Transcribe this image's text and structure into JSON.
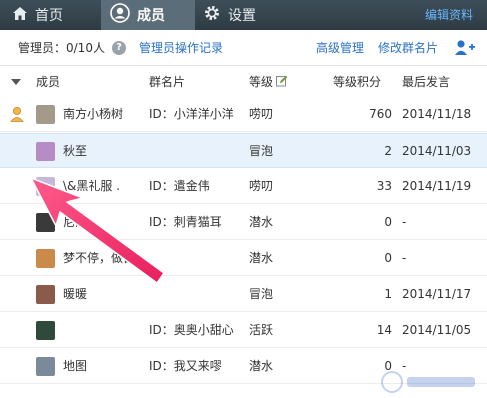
{
  "nav": {
    "tabs": [
      {
        "label": "首页",
        "icon": "home-icon",
        "active": false
      },
      {
        "label": "成员",
        "icon": "user-icon",
        "active": true
      },
      {
        "label": "设置",
        "icon": "gear-icon",
        "active": false
      }
    ],
    "edit_profile": "编辑资料"
  },
  "toolbar": {
    "admins": "管理员：0/10人",
    "admin_log": "管理员操作记录",
    "advanced_manage": "高级管理",
    "edit_group_card": "修改群名片"
  },
  "table": {
    "headers": [
      "成员",
      "群名片",
      "等级",
      "等级积分",
      "最后发言"
    ],
    "rows": [
      {
        "name": "南方小杨树",
        "card": "ID：小洋洋小洋",
        "level": "唠叨",
        "score": "760",
        "date": "2014/11/18",
        "owner": true,
        "selected": false,
        "avatar_color": "#a49a8a"
      },
      {
        "name": "秋至",
        "card": "",
        "level": "冒泡",
        "score": "2",
        "date": "2014/11/03",
        "owner": false,
        "selected": true,
        "avatar_color": "#b78cc4"
      },
      {
        "name": "\\&黑礼服 .",
        "card": "ID：遣金伟",
        "level": "唠叨",
        "score": "33",
        "date": "2014/11/19",
        "owner": false,
        "selected": false,
        "avatar_color": "#c7b8d6"
      },
      {
        "name": "尼洛",
        "card": "ID：刺青猫耳",
        "level": "潜水",
        "score": "0",
        "date": "-",
        "owner": false,
        "selected": false,
        "avatar_color": "#3a3a3a"
      },
      {
        "name": "梦不停，做目...",
        "card": "",
        "level": "潜水",
        "score": "0",
        "date": "-",
        "owner": false,
        "selected": false,
        "avatar_color": "#c98a4a"
      },
      {
        "name": "暖暖",
        "card": "",
        "level": "冒泡",
        "score": "1",
        "date": "2014/11/17",
        "owner": false,
        "selected": false,
        "avatar_color": "#8a5a4a"
      },
      {
        "name": "",
        "card": "ID：奥奥小甜心",
        "level": "活跃",
        "score": "14",
        "date": "2014/11/05",
        "owner": false,
        "selected": false,
        "avatar_color": "#2f4a3a"
      },
      {
        "name": "地图",
        "card": "ID：我又来嘐",
        "level": "潜水",
        "score": "0",
        "date": "-",
        "owner": false,
        "selected": false,
        "avatar_color": "#7a8a9a"
      }
    ]
  },
  "colors": {
    "nav_bg": "#2e3b44",
    "nav_active": "#5b6d78",
    "link": "#2a72c8",
    "selected_row": "#e8f2fc",
    "arrow": "#f0306a"
  }
}
